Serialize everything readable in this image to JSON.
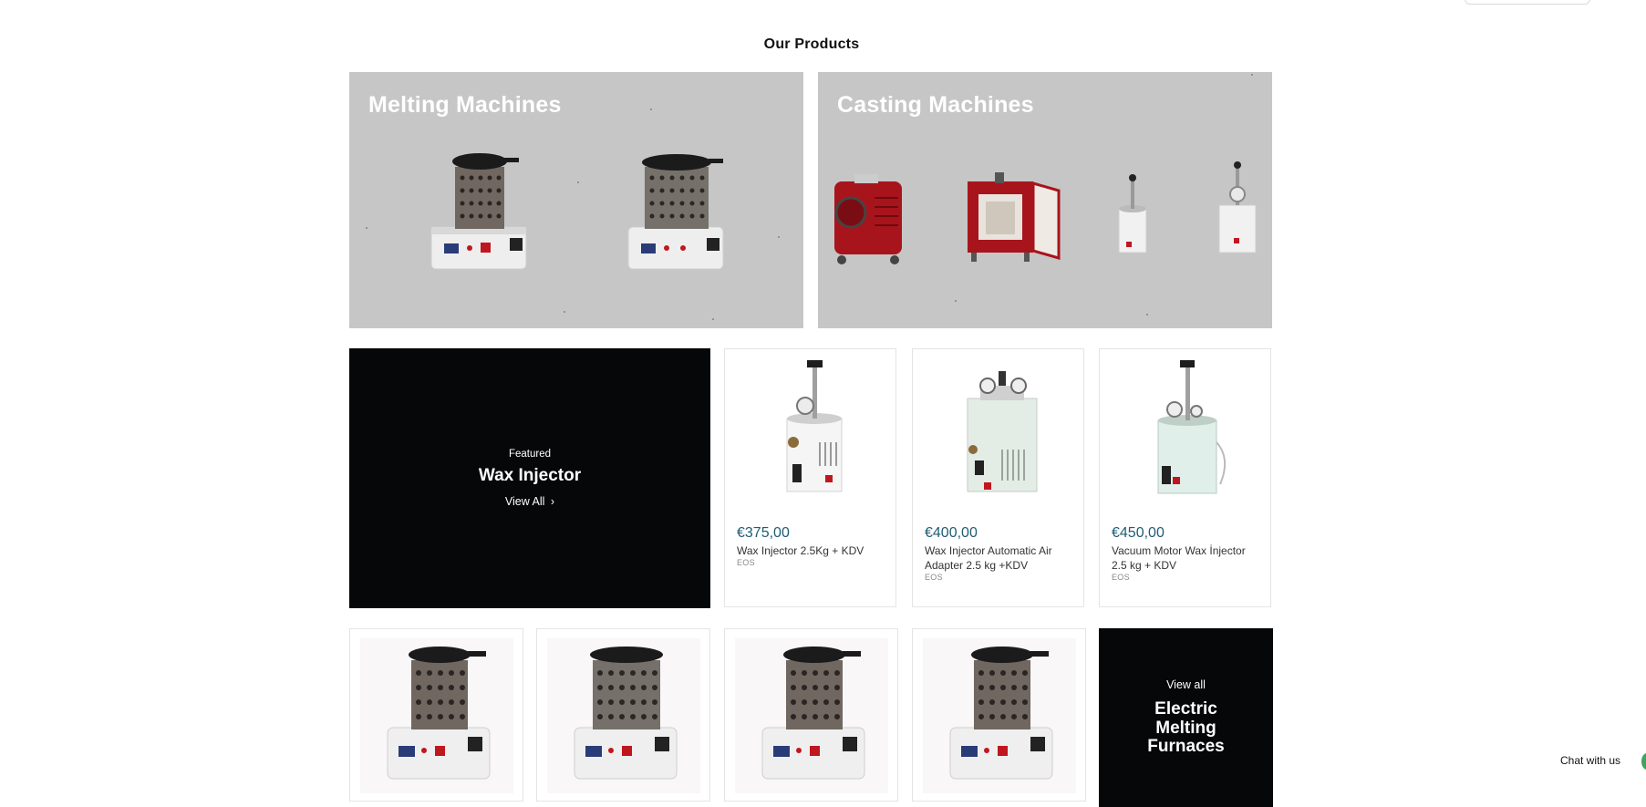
{
  "section": {
    "title": "Our Products"
  },
  "banners": [
    {
      "title": "Melting Machines"
    },
    {
      "title": "Casting Machines"
    }
  ],
  "featured": {
    "eyebrow": "Featured",
    "title": "Wax Injector",
    "link": "View All",
    "link_icon": "chevron-right-icon"
  },
  "products": [
    {
      "price": "€375,00",
      "name": "Wax Injector 2.5Kg + KDV",
      "vendor": "EOS"
    },
    {
      "price": "€400,00",
      "name": "Wax Injector Automatic Air Adapter 2.5 kg +KDV",
      "vendor": "EOS"
    },
    {
      "price": "€450,00",
      "name": "Vacuum Motor Wax İnjector 2.5 kg + KDV",
      "vendor": "EOS"
    }
  ],
  "furnace_collection": {
    "link": "View all",
    "title": "Electric Melting Furnaces"
  },
  "chat": {
    "label": "Chat with us"
  },
  "colors": {
    "banner_bg": "#c6c6c6",
    "dark_tile": "#050708",
    "price": "#1f5c73",
    "chat_accent": "#3fa35d"
  }
}
